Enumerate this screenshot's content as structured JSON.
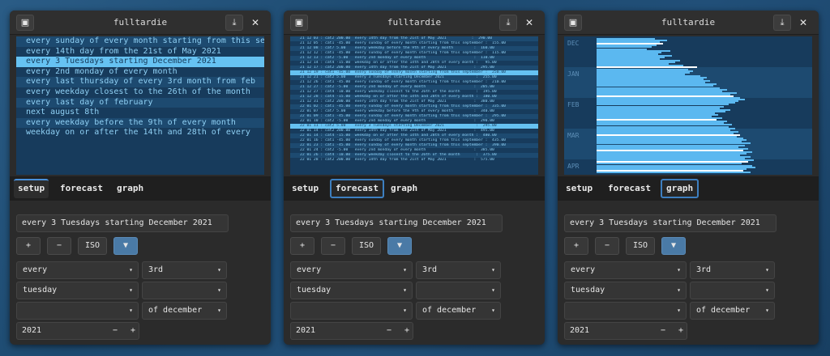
{
  "app_title": "fulltardie",
  "icons": {
    "window_icon": "app-icon",
    "download": "download-icon",
    "close": "close-icon"
  },
  "tabs": [
    "setup",
    "forecast",
    "graph"
  ],
  "colors": {
    "accent": "#4a90d9",
    "highlight": "#66c2f2",
    "bar": "#5bb8f0",
    "bar_white": "#ffffff",
    "list_bg": "#173b5c",
    "text_blue": "#8fd0f4"
  },
  "setup_list": {
    "selected_index": 2,
    "items": [
      "every sunday of every month starting from this september",
      "every 14th day from the 21st of May 2021",
      "every 3 Tuesdays starting December 2021",
      "every 2nd monday of every month",
      "every last thursday of every 3rd month from feb",
      "every weekday closest to the 26th of the month",
      "every last day of february",
      "next august 8th",
      "every weekday before the 9th of every month",
      "weekday on or after the 14th and 28th of every"
    ]
  },
  "forecast_list": {
    "selected_indices": [
      7,
      18
    ],
    "items": [
      "21 12 03 : cat2 200.00  every 14th day from the 21st of May 2021           :  290.00",
      "21 12 05 : cat1 -45.00  every sunday of every month starting from this september :  155.00",
      "21 12 08 : cat7 5.00    every weekday before the 9th of every month         :  160.00",
      "21 12 12 : cat1 -45.00  every sunday of every month starting from this september :  115.00",
      "21 12 13 : cat2 -5.00   every 2nd monday of every month                     :  110.00",
      "21 12 14 : cat4 -15.00  weekday on or after the 14th and 28th of every month :   95.00",
      "21 12 17 : cat2 200.00  every 14th day from the 21st of May 2021            :  295.00",
      "21 12 19 : cat1 -45.00  every sunday of every month starting from this september :  250.00",
      "21 12 21 : cat2 5.00    every 3 Tuesdays starting December 2021              :  255.00",
      "21 12 26 : cat1 -45.00  every sunday of every month starting from this september :  210.00",
      "21 12 27 : cat2 -5.00   every 2nd monday of every month                     :  205.00",
      "21 12 27 : cat4 -10.00  every weekday closest to the 26th of the month       :  195.00",
      "21 12 28 : cat4 -15.00  weekday on or after the 14th and 28th of every month :  180.00",
      "21 12 31 : cat2 200.00  every 14th day from the 21st of May 2021            :  380.00",
      "22 01 02 : cat1 -45.00  every sunday of every month starting from this september :  335.00",
      "22 01 07 : cat7 5.00    every weekday before the 9th of every month         :  340.00",
      "22 01 09 : cat1 -45.00  every sunday of every month starting from this september :  295.00",
      "22 01 10 : cat2 -5.00   every 2nd monday of every month                     :  290.00",
      "22 01 11 : cat2 5.00    every 3 Tuesdays starting December 2021              :  295.00",
      "22 01 14 : cat2 200.00  every 14th day from the 21st of May 2021            :  495.00",
      "22 01 14 : cat4 -15.00  weekday on or after the 14th and 28th of every month :  480.00",
      "22 01 16 : cat1 -45.00  every sunday of every month starting from this september :  435.00",
      "22 01 23 : cat1 -45.00  every sunday of every month starting from this september :  390.00",
      "22 01 24 : cat2 -5.00   every 2nd monday of every month                     :  385.00",
      "22 01 26 : cat4 -10.00  every weekday closest to the 26th of the month       :  375.00",
      "22 01 28 : cat2 200.00  every 14th day from the 21st of May 2021            :  575.00"
    ]
  },
  "graph": {
    "months": [
      "DEC",
      "JAN",
      "FEB",
      "MAR",
      "APR"
    ],
    "bars": [
      {
        "v": 0.35,
        "hl": false
      },
      {
        "v": 0.42,
        "hl": false
      },
      {
        "v": 0.38,
        "hl": false
      },
      {
        "v": 0.4,
        "hl": true
      },
      {
        "v": 0.36,
        "hl": false
      },
      {
        "v": 0.33,
        "hl": false
      },
      {
        "v": 0.3,
        "hl": false
      },
      {
        "v": 0.44,
        "hl": false
      },
      {
        "v": 0.39,
        "hl": false
      },
      {
        "v": 0.37,
        "hl": false
      },
      {
        "v": 0.45,
        "hl": false
      },
      {
        "v": 0.41,
        "hl": false
      },
      {
        "v": 0.38,
        "hl": false
      },
      {
        "v": 0.5,
        "hl": false
      },
      {
        "v": 0.47,
        "hl": false
      },
      {
        "v": 0.43,
        "hl": false
      },
      {
        "v": 0.52,
        "hl": false
      },
      {
        "v": 0.6,
        "hl": true
      },
      {
        "v": 0.55,
        "hl": false
      },
      {
        "v": 0.58,
        "hl": false
      },
      {
        "v": 0.56,
        "hl": false
      },
      {
        "v": 0.53,
        "hl": false
      },
      {
        "v": 0.62,
        "hl": false
      },
      {
        "v": 0.66,
        "hl": false
      },
      {
        "v": 0.64,
        "hl": false
      },
      {
        "v": 0.68,
        "hl": false
      },
      {
        "v": 0.65,
        "hl": false
      },
      {
        "v": 0.72,
        "hl": false
      },
      {
        "v": 0.7,
        "hl": false
      },
      {
        "v": 0.74,
        "hl": false
      },
      {
        "v": 0.78,
        "hl": false
      },
      {
        "v": 0.75,
        "hl": false
      },
      {
        "v": 0.84,
        "hl": false
      },
      {
        "v": 0.8,
        "hl": false
      },
      {
        "v": 0.82,
        "hl": true
      },
      {
        "v": 0.86,
        "hl": false
      },
      {
        "v": 0.89,
        "hl": false
      },
      {
        "v": 0.85,
        "hl": false
      },
      {
        "v": 0.83,
        "hl": false
      },
      {
        "v": 0.79,
        "hl": false
      },
      {
        "v": 0.76,
        "hl": false
      },
      {
        "v": 0.74,
        "hl": false
      },
      {
        "v": 0.8,
        "hl": false
      },
      {
        "v": 0.77,
        "hl": false
      },
      {
        "v": 0.71,
        "hl": false
      },
      {
        "v": 0.73,
        "hl": false
      },
      {
        "v": 0.69,
        "hl": false
      },
      {
        "v": 0.75,
        "hl": false
      },
      {
        "v": 0.72,
        "hl": true
      },
      {
        "v": 0.78,
        "hl": false
      },
      {
        "v": 0.76,
        "hl": false
      },
      {
        "v": 0.81,
        "hl": false
      },
      {
        "v": 0.79,
        "hl": false
      },
      {
        "v": 0.83,
        "hl": false
      },
      {
        "v": 0.8,
        "hl": false
      },
      {
        "v": 0.85,
        "hl": false
      },
      {
        "v": 0.82,
        "hl": false
      },
      {
        "v": 0.86,
        "hl": true
      },
      {
        "v": 0.84,
        "hl": false
      },
      {
        "v": 0.88,
        "hl": false
      },
      {
        "v": 0.9,
        "hl": false
      },
      {
        "v": 0.87,
        "hl": false
      },
      {
        "v": 0.92,
        "hl": false
      },
      {
        "v": 0.89,
        "hl": false
      },
      {
        "v": 0.85,
        "hl": false
      },
      {
        "v": 0.91,
        "hl": false
      },
      {
        "v": 0.88,
        "hl": true
      },
      {
        "v": 0.93,
        "hl": false
      },
      {
        "v": 0.9,
        "hl": false
      },
      {
        "v": 0.86,
        "hl": false
      },
      {
        "v": 0.92,
        "hl": false
      },
      {
        "v": 0.89,
        "hl": false
      },
      {
        "v": 0.94,
        "hl": false
      },
      {
        "v": 0.91,
        "hl": true
      },
      {
        "v": 0.87,
        "hl": false
      },
      {
        "v": 0.93,
        "hl": false
      },
      {
        "v": 0.95,
        "hl": false
      },
      {
        "v": 0.9,
        "hl": false
      },
      {
        "v": 0.88,
        "hl": true
      },
      {
        "v": 0.92,
        "hl": false
      }
    ]
  },
  "setup": {
    "entry_value": "every 3 Tuesdays starting December 2021",
    "buttons": {
      "plus": "+",
      "minus": "−",
      "iso": "ISO",
      "down": "▼"
    },
    "dropdowns": {
      "row1_left": "every",
      "row1_right": "3rd",
      "row2_left": "tuesday",
      "row2_right": "",
      "row3_left": "",
      "row3_right": "of december"
    },
    "year": "2021",
    "spin_minus": "−",
    "spin_plus": "+",
    "arrow": "▾"
  },
  "windows": [
    {
      "id": "win1",
      "active_tab": "setup"
    },
    {
      "id": "win2",
      "active_tab": "forecast"
    },
    {
      "id": "win3",
      "active_tab": "graph"
    }
  ]
}
